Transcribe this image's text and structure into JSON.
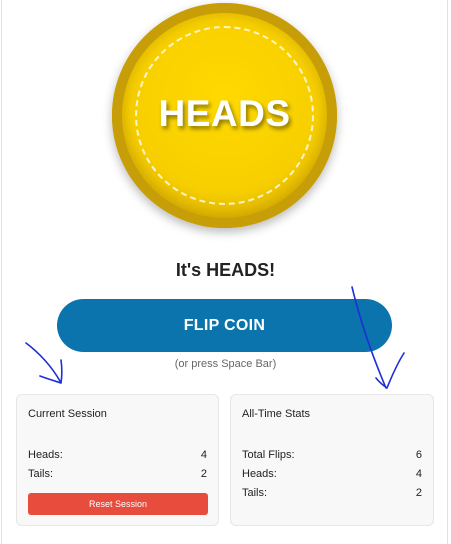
{
  "coin": {
    "face": "HEADS"
  },
  "result_text": "It's HEADS!",
  "flip_button": {
    "label": "FLIP COIN"
  },
  "hint": "(or press Space Bar)",
  "session": {
    "title": "Current Session",
    "heads_label": "Heads:",
    "heads_value": "4",
    "tails_label": "Tails:",
    "tails_value": "2",
    "reset_label": "Reset Session"
  },
  "all_time": {
    "title": "All-Time Stats",
    "total_label": "Total Flips:",
    "total_value": "6",
    "heads_label": "Heads:",
    "heads_value": "4",
    "tails_label": "Tails:",
    "tails_value": "2"
  },
  "colors": {
    "coin_gold": "#f7cf00",
    "flip_button": "#0b74ad",
    "reset_button": "#e74c3c",
    "annotation_ink": "#1f2fd6"
  }
}
